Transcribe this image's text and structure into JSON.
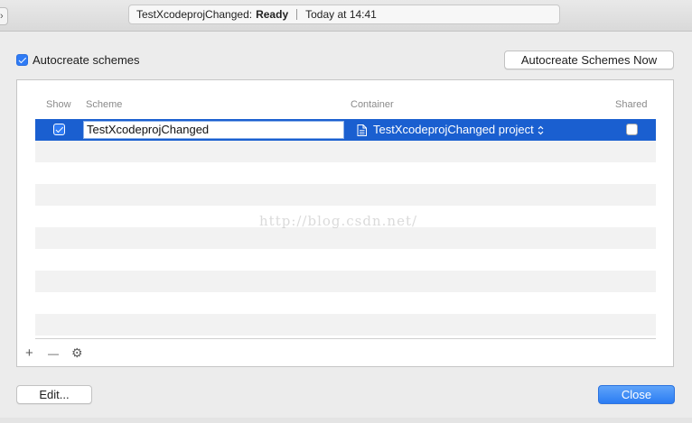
{
  "activity": {
    "project": "TestXcodeprojChanged:",
    "status": "Ready",
    "time": "Today at 14:41"
  },
  "autocreate": {
    "label": "Autocreate schemes",
    "checked": true
  },
  "buttons": {
    "autocreate_now": "Autocreate Schemes Now",
    "edit": "Edit...",
    "close": "Close"
  },
  "table": {
    "headers": {
      "show": "Show",
      "scheme": "Scheme",
      "container": "Container",
      "shared": "Shared"
    },
    "rows": [
      {
        "show": true,
        "scheme": "TestXcodeprojChanged",
        "container": "TestXcodeprojChanged project",
        "shared": false,
        "selected": true
      }
    ]
  },
  "toolbar": {
    "add_symbol": "+",
    "remove_symbol": "—",
    "gear_symbol": "⚙"
  },
  "watermark": "http://blog.csdn.net/",
  "colors": {
    "selection": "#1a5fd0",
    "accent": "#2f7bf5"
  }
}
